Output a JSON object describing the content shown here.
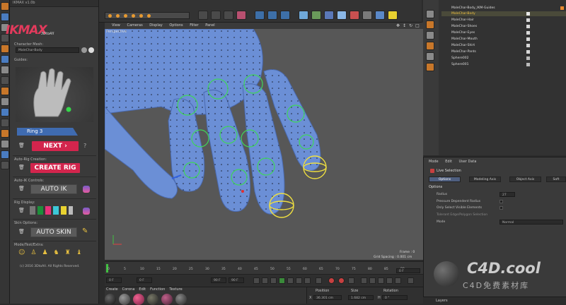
{
  "plugin": {
    "title": "IKMAX v1.0b",
    "logo_text": "IKMAX",
    "logo_sub": "3DtoAll",
    "character_mesh_label": "Character Mesh:",
    "character_mesh_value": "MaleChar-Body",
    "guides_label": "Guides:",
    "ring_label": "Ring 3",
    "next_label": "NEXT",
    "help_label": "?",
    "auto_rig_label": "Auto-Rig Creation:",
    "create_rig_label": "CREATE RIG",
    "auto_ik_section": "Auto-IK Controls:",
    "auto_ik_label": "AUTO IK",
    "rig_display_label": "Rig Display:",
    "skin_options_label": "Skin Options:",
    "auto_skin_label": "AUTO SKIN",
    "mode_label": "Mode/Test/Extra:",
    "copyright": "(c) 2016 3DtoAll. All Rights Reserved.",
    "swatch_colors": [
      "#1d8f3a",
      "#e8317a",
      "#3cc8d8",
      "#e8d230"
    ]
  },
  "viewport": {
    "menu": [
      "View",
      "Cameras",
      "Display",
      "Options",
      "Filter",
      "Panel"
    ],
    "label": "Perspective",
    "frame_text": "Frame : 0",
    "grid_text": "Grid Spacing : 0.001 cm"
  },
  "timeline": {
    "ticks": [
      "0",
      "5",
      "10",
      "15",
      "20",
      "25",
      "30",
      "35",
      "40",
      "45",
      "50",
      "55",
      "60",
      "65",
      "70",
      "75",
      "80",
      "85",
      "90"
    ],
    "frame_right": "0 F",
    "start_field": "0 F",
    "current_field": "0 F",
    "end_field": "90 F",
    "end2_field": "90 F"
  },
  "material_menu": [
    "Create",
    "Corona",
    "Edit",
    "Function",
    "Texture"
  ],
  "coords": {
    "position_label": "Position",
    "size_label": "Size",
    "rotation_label": "Rotation",
    "x_label": "X",
    "x_value": "36.301 cm",
    "size_value": "1.682 cm",
    "h_label": "H",
    "h_value": "0 °"
  },
  "objects": [
    "MaleChar-Body_IKM-Guides",
    "MaleChar-Body",
    "MaleChar-Hair",
    "MaleChar-Shoes",
    "MaleChar-Eyes",
    "MaleChar-Mouth",
    "MaleChar-Shirt",
    "MaleChar-Pants",
    "Sphere002",
    "Sphere001"
  ],
  "attributes": {
    "menu": [
      "Mode",
      "Edit",
      "User Data"
    ],
    "object_name": "Live Selection",
    "tabs": [
      "Options",
      "Modeling Axis",
      "Object Axis",
      "Soft Selection"
    ],
    "section": "Options",
    "radius_label": "Radius",
    "radius_value": "27",
    "pressure_label": "Pressure Dependent Radius",
    "visible_label": "Only Select Visible Elements",
    "tolerant_label": "Tolerant Edge/Polygon Selection",
    "mode_label": "Mode",
    "mode_value": "Normal"
  },
  "layers_label": "Layers",
  "watermark": {
    "main": "C4D.cool",
    "sub": "C4D免费素材库"
  }
}
